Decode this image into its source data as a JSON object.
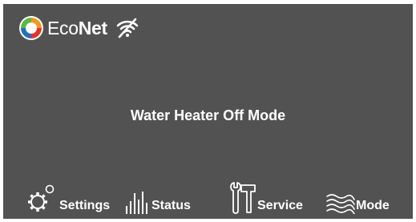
{
  "header": {
    "brand_eco": "Eco",
    "brand_net": "Net",
    "logo_icon": "econet-logo-icon",
    "wifi_icon": "wifi-off-icon",
    "colors": {
      "background": "#525252",
      "text": "#ffffff"
    }
  },
  "main": {
    "status_message": "Water Heater Off Mode"
  },
  "nav": {
    "settings_label": "Settings",
    "status_label": "Status",
    "service_label": "Service",
    "mode_label": "Mode"
  }
}
